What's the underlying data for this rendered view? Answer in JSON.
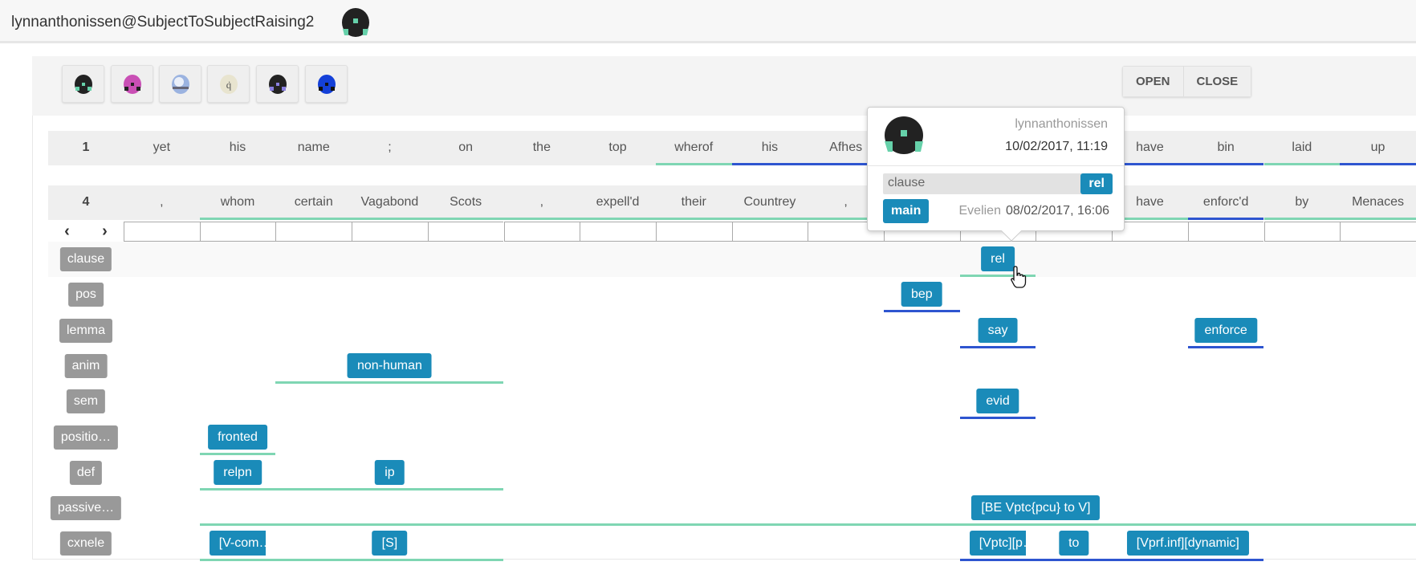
{
  "header": {
    "title": "lynnanthonissen@SubjectToSubjectRaising2",
    "avatar_icon": "user-avatar-icon"
  },
  "toolbar": {
    "avatars": [
      {
        "icon": "avatar-black-green-icon",
        "color": "#222222",
        "accent": "#66d1aa"
      },
      {
        "icon": "avatar-magenta-icon",
        "color": "#c94fb5",
        "accent": "#222222"
      },
      {
        "icon": "avatar-sphere-icon",
        "color": "#9bb3e0",
        "accent": "#ffffff"
      },
      {
        "icon": "avatar-letter-q-icon",
        "color": "#e8e4cf",
        "accent": "#555555"
      },
      {
        "icon": "avatar-purple-icon",
        "color": "#222222",
        "accent": "#8a7fe0"
      },
      {
        "icon": "avatar-blue-icon",
        "color": "#1440d8",
        "accent": "#111111"
      }
    ],
    "open_label": "OPEN",
    "close_label": "CLOSE"
  },
  "sentences": [
    {
      "number": "1",
      "words": [
        "yet",
        "his",
        "name",
        ";",
        "on",
        "the",
        "top",
        "wherof",
        "his",
        "Afhes",
        "",
        "",
        "",
        "have",
        "bin",
        "laid",
        "up"
      ]
    },
    {
      "number": "4",
      "words": [
        ",",
        "whom",
        "certain",
        "Vagabond",
        "Scots",
        ",",
        "expell'd",
        "their",
        "Countrey",
        ",",
        "",
        "",
        "",
        "have",
        "enforc'd",
        "by",
        "Menaces"
      ]
    }
  ],
  "nav": {
    "prev": "‹",
    "next": "›"
  },
  "layers": [
    {
      "label": "clause",
      "annotations": [
        {
          "value": "rel"
        }
      ]
    },
    {
      "label": "pos",
      "annotations": [
        {
          "value": "bep"
        }
      ]
    },
    {
      "label": "lemma",
      "annotations": [
        {
          "value": "say"
        },
        {
          "value": "enforce"
        }
      ]
    },
    {
      "label": "anim",
      "annotations": [
        {
          "value": "non-human"
        }
      ]
    },
    {
      "label": "sem",
      "annotations": [
        {
          "value": "evid"
        }
      ]
    },
    {
      "label": "positio…",
      "annotations": [
        {
          "value": "fronted"
        }
      ]
    },
    {
      "label": "def",
      "annotations": [
        {
          "value": "relpn"
        },
        {
          "value": "ip"
        }
      ]
    },
    {
      "label": "passive…",
      "annotations": [
        {
          "value": "[BE Vptc{pcu} to V]"
        }
      ]
    },
    {
      "label": "cxnele",
      "annotations": [
        {
          "value": "[V-com…"
        },
        {
          "value": "[S]"
        },
        {
          "value": "[Vptc][p…"
        },
        {
          "value": "to"
        },
        {
          "value": "[Vprf.inf][dynamic]"
        }
      ]
    }
  ],
  "popup": {
    "user": "lynnanthonissen",
    "date": "10/02/2017, 11:19",
    "layer": "clause",
    "value": "rel",
    "previous_value": "main",
    "previous_user": "Evelien",
    "previous_date": "08/02/2017, 16:06"
  },
  "colors": {
    "chip": "#1a8bb9",
    "label": "#999999",
    "span_green": "#7fd6b3",
    "span_blue": "#2e55d0"
  }
}
